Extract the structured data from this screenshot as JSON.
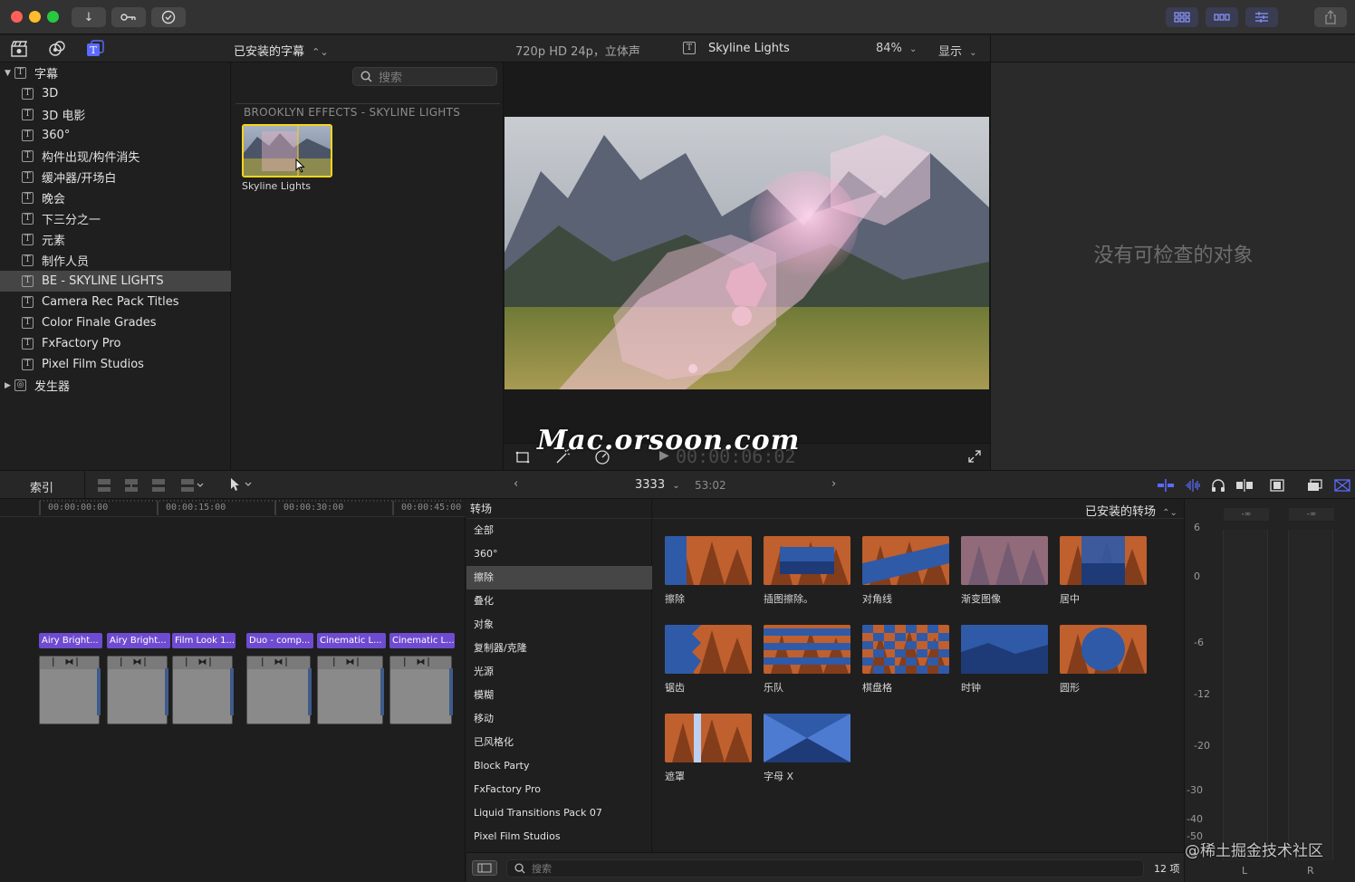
{
  "app": {
    "toolbar_icons": [
      "import-icon",
      "keywords-icon",
      "background-tasks-icon"
    ],
    "right_icons": [
      "browser-view-icon",
      "timeline-view-icon",
      "inspector-view-icon",
      "share-icon"
    ]
  },
  "library": {
    "header_title": "已安装的字幕",
    "tabs": [
      "media-icon",
      "photos-audio-icon",
      "titles-generators-icon"
    ],
    "items": [
      {
        "label": "字幕",
        "level": 0,
        "caret": "▼"
      },
      {
        "label": "3D",
        "level": 1
      },
      {
        "label": "3D 电影",
        "level": 1
      },
      {
        "label": "360°",
        "level": 1
      },
      {
        "label": "构件出现/构件消失",
        "level": 1
      },
      {
        "label": "缓冲器/开场白",
        "level": 1
      },
      {
        "label": "晚会",
        "level": 1
      },
      {
        "label": "下三分之一",
        "level": 1
      },
      {
        "label": "元素",
        "level": 1
      },
      {
        "label": "制作人员",
        "level": 1
      },
      {
        "label": "BE - SKYLINE LIGHTS",
        "level": 1,
        "selected": true
      },
      {
        "label": "Camera Rec Pack Titles",
        "level": 1
      },
      {
        "label": "Color Finale Grades",
        "level": 1
      },
      {
        "label": "FxFactory Pro",
        "level": 1
      },
      {
        "label": "Pixel Film Studios",
        "level": 1
      },
      {
        "label": "发生器",
        "level": 0,
        "caret": "▶"
      }
    ]
  },
  "browser": {
    "search_placeholder": "搜索",
    "section_title": "BROOKLYN EFFECTS - SKYLINE LIGHTS",
    "item_label": "Skyline Lights"
  },
  "viewer": {
    "format": "720p HD 24p，立体声",
    "clip_name": "Skyline Lights",
    "zoom": "84%",
    "display_menu": "显示",
    "timecode": "00:00:06:02",
    "watermark": "Mac.orsoon.com"
  },
  "inspector": {
    "empty_text": "没有可检查的对象"
  },
  "timeline": {
    "index_label": "索引",
    "project_name": "3333",
    "duration": "53:02",
    "ruler": [
      "00:00:00:00",
      "00:00:15:00",
      "00:00:30:00",
      "00:00:45:00"
    ],
    "clips": [
      "Airy Bright...",
      "Airy Bright...",
      "Film Look 1...",
      "Duo - comp...",
      "Cinematic L...",
      "Cinematic L..."
    ]
  },
  "transitions": {
    "header": "转场",
    "installed_label": "已安装的转场",
    "categories": [
      "全部",
      "360°",
      "擦除",
      "叠化",
      "对象",
      "复制器/克隆",
      "光源",
      "模糊",
      "移动",
      "已风格化",
      "Block Party",
      "FxFactory Pro",
      "Liquid Transitions Pack 07",
      "Pixel Film Studios"
    ],
    "selected_category": "擦除",
    "items": [
      "擦除",
      "插图擦除。",
      "对角线",
      "渐变图像",
      "居中",
      "锯齿",
      "乐队",
      "棋盘格",
      "时钟",
      "圆形",
      "遮罩",
      "字母 X"
    ],
    "search_placeholder": "搜索",
    "count": "12 项"
  },
  "meters": {
    "peak_l": "-∞",
    "peak_r": "-∞",
    "scale": [
      "6",
      "0",
      "-6",
      "-12",
      "-20",
      "-30",
      "-40",
      "-50",
      "-∞"
    ],
    "channels": [
      "L",
      "R"
    ]
  },
  "overlay": {
    "corner_watermark": "@稀土掘金技术社区"
  },
  "colors": {
    "accent_purple": "#6f4bd1",
    "selection_yellow": "#f5d51e",
    "tool_blue": "#5b6bff"
  }
}
